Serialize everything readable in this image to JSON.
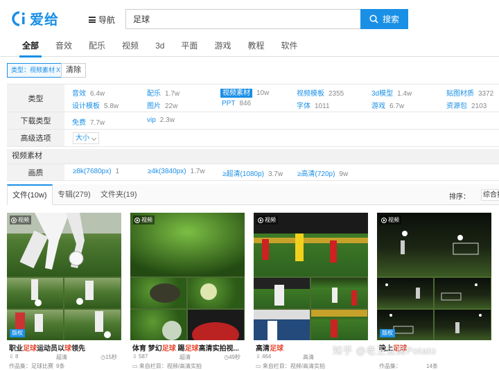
{
  "header": {
    "logo_text": "爱给",
    "nav_label": "导航",
    "search_value": "足球",
    "search_button": "搜索"
  },
  "categories": [
    "全部",
    "音效",
    "配乐",
    "视频",
    "3d",
    "平面",
    "游戏",
    "教程",
    "软件"
  ],
  "active_filter": {
    "chip": "类型：视频素材",
    "chip_x": "X",
    "clear": "清除"
  },
  "filters": {
    "type_label": "类型",
    "type_row1": [
      {
        "name": "音效",
        "count": "6.4w"
      },
      {
        "name": "配乐",
        "count": "1.7w"
      },
      {
        "name": "视频素材",
        "count": "10w"
      },
      {
        "name": "视频模板",
        "count": "2355"
      },
      {
        "name": "3d模型",
        "count": "1.4w"
      },
      {
        "name": "贴图材质",
        "count": "3372"
      }
    ],
    "type_row2": [
      {
        "name": "设计模板",
        "count": "5.8w"
      },
      {
        "name": "图片",
        "count": "22w"
      },
      {
        "name": "PPT",
        "count": "846"
      },
      {
        "name": "字体",
        "count": "1011"
      },
      {
        "name": "游戏",
        "count": "6.7w"
      },
      {
        "name": "资源包",
        "count": "2103"
      }
    ],
    "download_label": "下载类型",
    "download": [
      {
        "name": "免费",
        "count": "7.7w"
      },
      {
        "name": "vip",
        "count": "2.3w"
      }
    ],
    "advanced_label": "高级选项",
    "advanced_select": "大小",
    "section_title": "视频素材",
    "quality_label": "画质",
    "quality": [
      {
        "name": "≥8k(7680px)",
        "count": "1"
      },
      {
        "name": "≥4k(3840px)",
        "count": "1.7w"
      },
      {
        "name": "≥超清(1080p)",
        "count": "3.7w"
      },
      {
        "name": "≥高清(720p)",
        "count": "9w"
      }
    ]
  },
  "result_tabs": [
    "文件(10w)",
    "专辑(279)",
    "文件夹(19)"
  ],
  "sort": {
    "label": "排序：",
    "value": "综合排序"
  },
  "cards": [
    {
      "tag": "视频",
      "badge": "版权",
      "title_pre": "职业",
      "title_hl1": "足球",
      "title_mid": "运动员以",
      "title_hl2": "球",
      "title_post": "领先",
      "views": "8",
      "quality": "超清",
      "duration": "15秒",
      "from_label": "作品集：",
      "from": "足球比赛",
      "from_count": "9条"
    },
    {
      "tag": "视频",
      "badge": "",
      "title_pre": "体育 梦幻",
      "title_hl1": "足球",
      "title_mid": " 踢",
      "title_hl2": "足球",
      "title_post": "高清实拍视...",
      "views": "587",
      "quality": "超清",
      "duration": "49秒",
      "from_label": "来自栏目：",
      "from": "视频/高清实拍",
      "from_count": ""
    },
    {
      "tag": "视频",
      "badge": "",
      "title_pre": "高清",
      "title_hl1": "足球",
      "title_mid": "",
      "title_hl2": "",
      "title_post": "",
      "views": "464",
      "quality": "高清",
      "duration": "",
      "from_label": "来自栏目：",
      "from": "视频/高清实拍",
      "from_count": ""
    },
    {
      "tag": "视频",
      "badge": "版权",
      "title_pre": "晚上",
      "title_hl1": "",
      "title_mid": "",
      "title_hl2": "足球",
      "title_post": "",
      "views": "",
      "quality": "",
      "duration": "",
      "from_label": "作品集：",
      "from": "",
      "from_count": "14条"
    }
  ],
  "watermark": "知乎 @老王豆腐Potato"
}
